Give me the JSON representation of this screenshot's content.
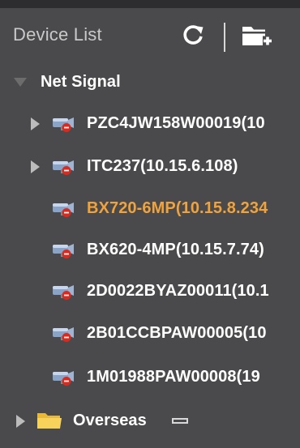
{
  "header": {
    "title": "Device List",
    "refresh_icon": "refresh-icon",
    "add_folder_icon": "folder-add-icon"
  },
  "tree": {
    "group": {
      "label": "Net Signal",
      "expanded": true,
      "expander_icon": "chevron-down-icon"
    },
    "devices": [
      {
        "label": "PZC4JW158W00019(10",
        "expandable": true,
        "selected": false,
        "icon": "camera-offline-icon"
      },
      {
        "label": "ITC237(10.15.6.108)",
        "expandable": true,
        "selected": false,
        "icon": "camera-offline-icon"
      },
      {
        "label": "BX720-6MP(10.15.8.234",
        "expandable": false,
        "selected": true,
        "icon": "camera-offline-icon"
      },
      {
        "label": "BX620-4MP(10.15.7.74)",
        "expandable": false,
        "selected": false,
        "icon": "camera-offline-icon"
      },
      {
        "label": "2D0022BYAZ00011(10.1",
        "expandable": false,
        "selected": false,
        "icon": "camera-offline-icon"
      },
      {
        "label": "2B01CCBPAW00005(10",
        "expandable": false,
        "selected": false,
        "icon": "camera-offline-icon"
      },
      {
        "label": "1M01988PAW00008(19",
        "expandable": false,
        "selected": false,
        "icon": "camera-offline-icon"
      }
    ],
    "folder": {
      "label": "Overseas",
      "expanded": false,
      "icon": "folder-icon",
      "collapse_icon": "minus-icon"
    }
  },
  "colors": {
    "background": "#4a4a4c",
    "text": "#ffffff",
    "selected_text": "#f0a33c",
    "header_text": "#c9c9c9"
  }
}
